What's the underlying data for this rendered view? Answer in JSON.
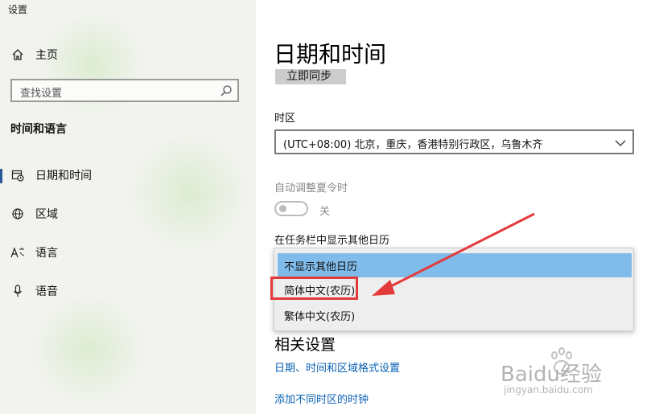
{
  "window": {
    "title": "设置"
  },
  "sidebar": {
    "home_label": "主页",
    "search_placeholder": "查找设置",
    "section_label": "时间和语言",
    "items": [
      {
        "label": "日期和时间",
        "icon": "calendar-clock-icon",
        "active": true
      },
      {
        "label": "区域",
        "icon": "globe-icon",
        "active": false
      },
      {
        "label": "语言",
        "icon": "language-icon",
        "active": false
      },
      {
        "label": "语音",
        "icon": "microphone-icon",
        "active": false
      }
    ]
  },
  "main": {
    "title": "日期和时间",
    "sync_button_label": "立即同步",
    "timezone_label": "时区",
    "timezone_value": "(UTC+08:00) 北京，重庆，香港特别行政区，乌鲁木齐",
    "dst_label": "自动调整夏令时",
    "dst_toggle_state": "关",
    "calendar_label": "在任务栏中显示其他日历",
    "calendar_options": [
      {
        "label": "不显示其他日历",
        "selected": true
      },
      {
        "label": "简体中文(农历)",
        "selected": false
      },
      {
        "label": "繁体中文(农历)",
        "selected": false
      }
    ],
    "related_title": "相关设置",
    "links": [
      "日期、时间和区域格式设置",
      "添加不同时区的时钟"
    ]
  },
  "watermark": {
    "brand": "Baidu经验",
    "url": "jingyan.baidu.com"
  },
  "colors": {
    "sidebar_bg": "#f2f3ef",
    "accent_blue": "#2b5797",
    "selected_option": "#7fbcec",
    "link": "#0b63b6",
    "annotation_red": "#e33b3b"
  }
}
